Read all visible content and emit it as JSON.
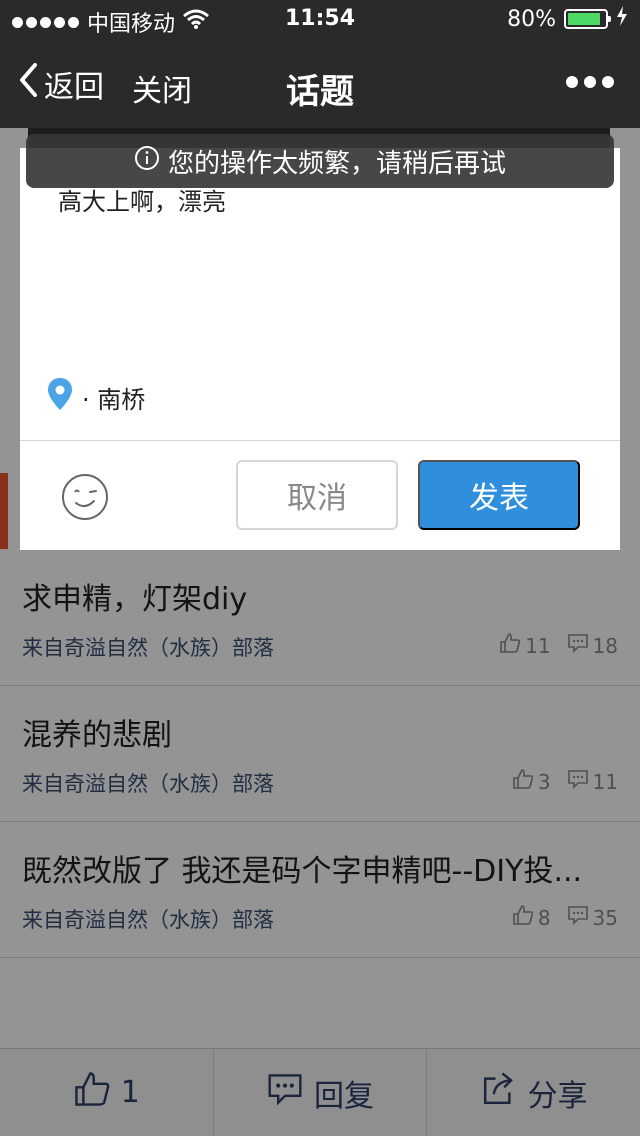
{
  "status_bar": {
    "carrier": "中国移动",
    "time": "11:54",
    "battery_percent": "80%",
    "battery_level": 0.8,
    "battery_color": "#4cd964"
  },
  "nav": {
    "back_label": "返回",
    "close_label": "关闭",
    "title": "话题",
    "more_icon": "more-icon"
  },
  "dialog": {
    "text": "高大上啊，漂亮",
    "location": "· 南桥",
    "cancel_label": "取消",
    "submit_label": "发表",
    "submit_color": "#2f8fdc"
  },
  "toast": {
    "message": "您的操作太频繁，请稍后再试"
  },
  "posts": [
    {
      "title": "求申精，灯架diy",
      "source": "来自奇溢自然（水族）部落",
      "likes": "11",
      "comments": "18"
    },
    {
      "title": "混养的悲剧",
      "source": "来自奇溢自然（水族）部落",
      "likes": "3",
      "comments": "11"
    },
    {
      "title": "既然改版了 我还是码个字申精吧--DIY投...",
      "source": "来自奇溢自然（水族）部落",
      "likes": "8",
      "comments": "35"
    }
  ],
  "bottom_bar": {
    "like_count": "1",
    "reply_label": "回复",
    "share_label": "分享"
  }
}
